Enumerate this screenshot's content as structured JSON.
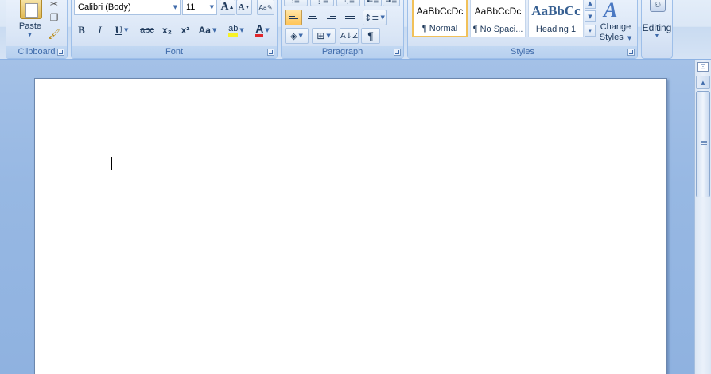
{
  "ribbon": {
    "clipboard": {
      "label": "Clipboard",
      "paste_label": "Paste"
    },
    "font": {
      "label": "Font",
      "font_name": "Calibri (Body)",
      "font_size": "11",
      "grow_font": "A",
      "shrink_font": "A",
      "bold": "B",
      "italic": "I",
      "underline": "U",
      "strikethrough": "abc",
      "subscript": "x₂",
      "superscript": "x²",
      "change_case": "Aa",
      "highlight": "ab",
      "font_color": "A",
      "font_color_hex": "#e0262b",
      "highlight_hex": "#f7f226"
    },
    "paragraph": {
      "label": "Paragraph",
      "show_marks": "¶"
    },
    "styles": {
      "label": "Styles",
      "gallery": [
        {
          "sample": "AaBbCcDc",
          "name": "¶ Normal",
          "selected": true
        },
        {
          "sample": "AaBbCcDc",
          "name": "¶ No Spaci...",
          "selected": false
        },
        {
          "sample": "AaBbCc",
          "name": "Heading 1",
          "selected": false
        }
      ],
      "change_styles_label": "Change Styles"
    },
    "editing": {
      "label": "Editing"
    }
  },
  "colors": {
    "ribbon_bg": "#dbe7f6",
    "workspace_bg": "#9dbce5",
    "group_label": "#3e6aaa",
    "selected_style_border": "#f1c15a"
  }
}
